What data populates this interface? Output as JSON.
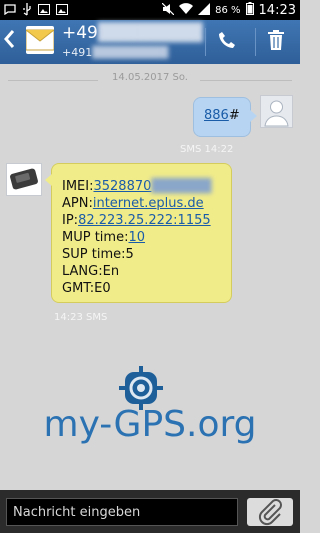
{
  "status_bar": {
    "battery": "86 %",
    "time": "14:23",
    "icons_left": [
      "chat-icon",
      "usb-icon",
      "image-icon",
      "image-icon"
    ],
    "icons_right": [
      "mute-icon",
      "wifi-icon",
      "signal-icon",
      "battery-icon"
    ]
  },
  "app_bar": {
    "contact_name": "+49",
    "contact_number": "+491"
  },
  "conversation": {
    "date_separator": "14.05.2017 So.",
    "outgoing": {
      "text_link": "886",
      "text_suffix": "#",
      "meta": "SMS 14:22"
    },
    "incoming": {
      "imei_label": "IMEI:",
      "imei_value": "3528870",
      "apn_label": "APN:",
      "apn_value": "internet.eplus.de",
      "ip_label": "IP:",
      "ip_value": "82.223.25.222:1155",
      "mup_label": "MUP time:",
      "mup_value": "10",
      "sup": "SUP time:5",
      "lang": "LANG:En",
      "gmt": "GMT:E0",
      "meta": "14:23 SMS"
    }
  },
  "watermark": {
    "text": "my-GPS.org"
  },
  "composer": {
    "placeholder": "Nachricht eingeben"
  },
  "colors": {
    "app_bar": "#3a6da7",
    "incoming_bubble": "#f1ec8a",
    "outgoing_bubble": "#b7d5f2",
    "background": "#d6d6d6",
    "link": "#1a5ca8"
  }
}
